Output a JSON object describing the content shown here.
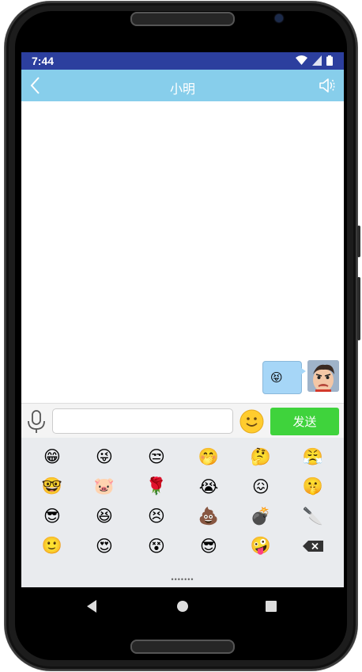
{
  "status_bar": {
    "time": "7:44"
  },
  "app_bar": {
    "title": "小明"
  },
  "chat": {
    "messages": [
      {
        "from": "me",
        "content": "😝"
      }
    ]
  },
  "input_bar": {
    "text_value": "",
    "send_label": "发送"
  },
  "emoji_panel": {
    "emojis": [
      "😁",
      "😜",
      "😒",
      "🤭",
      "🤔",
      "😤",
      "🤓",
      "🐷",
      "🌹",
      "😭",
      "😖",
      "🤫",
      "😎",
      "😆",
      "😣",
      "💩",
      "💣",
      "🔪",
      "🙂",
      "😍",
      "😵",
      "😎",
      "🤪"
    ],
    "page_indicator": "•••••••"
  },
  "colors": {
    "status_bar": "#2c3f9e",
    "app_bar": "#87ceeb",
    "send_button": "#3fd33c",
    "bubble": "#a6d6f7"
  }
}
